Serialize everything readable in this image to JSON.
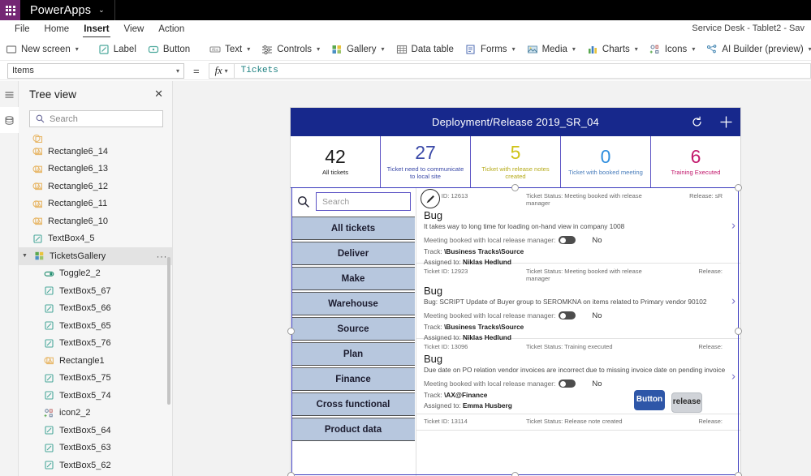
{
  "topbar": {
    "waffle_icon": "waffle-grid-icon",
    "app_name": "PowerApps",
    "caret": "⌄"
  },
  "menubar": {
    "items": [
      {
        "label": "File",
        "active": false
      },
      {
        "label": "Home",
        "active": false
      },
      {
        "label": "Insert",
        "active": true
      },
      {
        "label": "View",
        "active": false
      },
      {
        "label": "Action",
        "active": false
      }
    ],
    "right_status": "Service Desk - Tablet2 - Sav"
  },
  "ribbon": {
    "groups": [
      {
        "items": [
          {
            "label": "New screen",
            "icon": "new-screen-icon",
            "caret": true
          }
        ]
      },
      {
        "items": [
          {
            "label": "Label",
            "icon": "label-icon",
            "caret": false
          },
          {
            "label": "Button",
            "icon": "button-icon",
            "caret": false
          }
        ]
      },
      {
        "items": [
          {
            "label": "Text",
            "icon": "text-icon",
            "caret": true
          },
          {
            "label": "Controls",
            "icon": "controls-icon",
            "caret": true
          },
          {
            "label": "Gallery",
            "icon": "gallery-icon",
            "caret": true
          },
          {
            "label": "Data table",
            "icon": "data-table-icon",
            "caret": false
          },
          {
            "label": "Forms",
            "icon": "forms-icon",
            "caret": true
          },
          {
            "label": "Media",
            "icon": "media-icon",
            "caret": true
          },
          {
            "label": "Charts",
            "icon": "charts-icon",
            "caret": true
          },
          {
            "label": "Icons",
            "icon": "icons-icon",
            "caret": true
          },
          {
            "label": "AI Builder (preview)",
            "icon": "ai-builder-icon",
            "caret": true
          }
        ]
      }
    ]
  },
  "propertybar": {
    "property_selected": "Items",
    "equals": "=",
    "fx_label": "fx",
    "formula_value": "Tickets"
  },
  "rail": {
    "items": [
      {
        "name": "hamburger-menu-icon",
        "selected": false
      },
      {
        "name": "data-sources-icon",
        "selected": true
      }
    ]
  },
  "treeview": {
    "title": "Tree view",
    "close_icon": "close-icon",
    "search_placeholder": "Search",
    "search_icon": "search-icon",
    "items": [
      {
        "label": "",
        "icon": "rectangle-icon",
        "indent": 1,
        "selected": false,
        "partial": true
      },
      {
        "label": "Rectangle6_14",
        "icon": "rectangle-icon",
        "indent": 1,
        "selected": false
      },
      {
        "label": "Rectangle6_13",
        "icon": "rectangle-icon",
        "indent": 1,
        "selected": false
      },
      {
        "label": "Rectangle6_12",
        "icon": "rectangle-icon",
        "indent": 1,
        "selected": false
      },
      {
        "label": "Rectangle6_11",
        "icon": "rectangle-icon",
        "indent": 1,
        "selected": false
      },
      {
        "label": "Rectangle6_10",
        "icon": "rectangle-icon",
        "indent": 1,
        "selected": false
      },
      {
        "label": "TextBox4_5",
        "icon": "textbox-icon",
        "indent": 1,
        "selected": false
      },
      {
        "label": "TicketsGallery",
        "icon": "gallery-icon",
        "indent": 0,
        "selected": true,
        "expanded": true,
        "overflow": "···"
      },
      {
        "label": "Toggle2_2",
        "icon": "toggle-icon",
        "indent": 2,
        "selected": false
      },
      {
        "label": "TextBox5_67",
        "icon": "textbox-icon",
        "indent": 2,
        "selected": false
      },
      {
        "label": "TextBox5_66",
        "icon": "textbox-icon",
        "indent": 2,
        "selected": false
      },
      {
        "label": "TextBox5_65",
        "icon": "textbox-icon",
        "indent": 2,
        "selected": false
      },
      {
        "label": "TextBox5_76",
        "icon": "textbox-icon",
        "indent": 2,
        "selected": false
      },
      {
        "label": "Rectangle1",
        "icon": "rectangle-icon",
        "indent": 2,
        "selected": false
      },
      {
        "label": "TextBox5_75",
        "icon": "textbox-icon",
        "indent": 2,
        "selected": false
      },
      {
        "label": "TextBox5_74",
        "icon": "textbox-icon",
        "indent": 2,
        "selected": false
      },
      {
        "label": "icon2_2",
        "icon": "icons-icon",
        "indent": 2,
        "selected": false
      },
      {
        "label": "TextBox5_64",
        "icon": "textbox-icon",
        "indent": 2,
        "selected": false
      },
      {
        "label": "TextBox5_63",
        "icon": "textbox-icon",
        "indent": 2,
        "selected": false
      },
      {
        "label": "TextBox5_62",
        "icon": "textbox-icon",
        "indent": 2,
        "selected": false
      }
    ]
  },
  "app": {
    "header": {
      "title": "Deployment/Release 2019_SR_04",
      "refresh_icon": "refresh-icon",
      "add_icon": "plus-icon",
      "bg_color": "#17288c"
    },
    "kpis": [
      {
        "value": "42",
        "label": "All tickets",
        "color": "#1b1b1b",
        "label_color": "#1b1b1b"
      },
      {
        "value": "27",
        "label": "Ticket need to communicate to local site",
        "color": "#3b4aa8",
        "label_color": "#3b4aa8"
      },
      {
        "value": "5",
        "label": "Ticket with release notes created",
        "color": "#cfc318",
        "label_color": "#b5aa18"
      },
      {
        "value": "0",
        "label": "Ticket with booked meeting",
        "color": "#2f8ede",
        "label_color": "#4b7fbd"
      },
      {
        "value": "6",
        "label": "Training Executed",
        "color": "#c2186c",
        "label_color": "#c2186c"
      }
    ],
    "search": {
      "placeholder": "Search",
      "icon": "search-icon"
    },
    "nav_buttons": [
      {
        "label": "All tickets"
      },
      {
        "label": "Deliver"
      },
      {
        "label": "Make"
      },
      {
        "label": "Warehouse"
      },
      {
        "label": "Source"
      },
      {
        "label": "Plan"
      },
      {
        "label": "Finance"
      },
      {
        "label": "Cross functional"
      },
      {
        "label": "Product data"
      }
    ],
    "gallery": {
      "toggle_label": "Meeting booked with local release manager:",
      "track_label": "Track:",
      "assigned_label": "Assigned to:",
      "chevron_icon": "chevron-right-icon",
      "rows": [
        {
          "id_label": "Ticket ID: 12613",
          "status_label": "Ticket Status: Meeting booked with release manager",
          "release_label": "Release: sR",
          "title": "Bug",
          "description": "It takes way to long time for loading on-hand view in company 1008",
          "toggle_value": "No",
          "track": "\\Business Tracks\\Source",
          "assigned_to": "Niklas Hedlund"
        },
        {
          "id_label": "Ticket ID: 12923",
          "status_label": "Ticket Status: Meeting booked with release manager",
          "release_label": "Release:",
          "title": "Bug",
          "description": "Bug: SCRIPT Update of Buyer group to SEROMKNA on items related to Primary vendor 90102",
          "toggle_value": "No",
          "track": "\\Business Tracks\\Source",
          "assigned_to": "Niklas Hedlund"
        },
        {
          "id_label": "Ticket ID: 13096",
          "status_label": "Ticket Status: Training executed",
          "release_label": "Release:",
          "title": "Bug",
          "description": "Due date on PO relation vendor invoices are incorrect due to missing invoice date on pending invoice",
          "toggle_value": "No",
          "track": "\\AX@Finance",
          "assigned_to": "Emma Husberg"
        }
      ],
      "partial_row": {
        "id_label": "Ticket ID: 13114",
        "status_label": "Ticket Status: Release note created",
        "release_label": "Release:"
      }
    },
    "loose_controls": [
      {
        "label": "Button",
        "style": "blue",
        "name": "loose-button-control"
      },
      {
        "label": "release",
        "style": "gray",
        "name": "loose-release-button-control"
      }
    ]
  }
}
